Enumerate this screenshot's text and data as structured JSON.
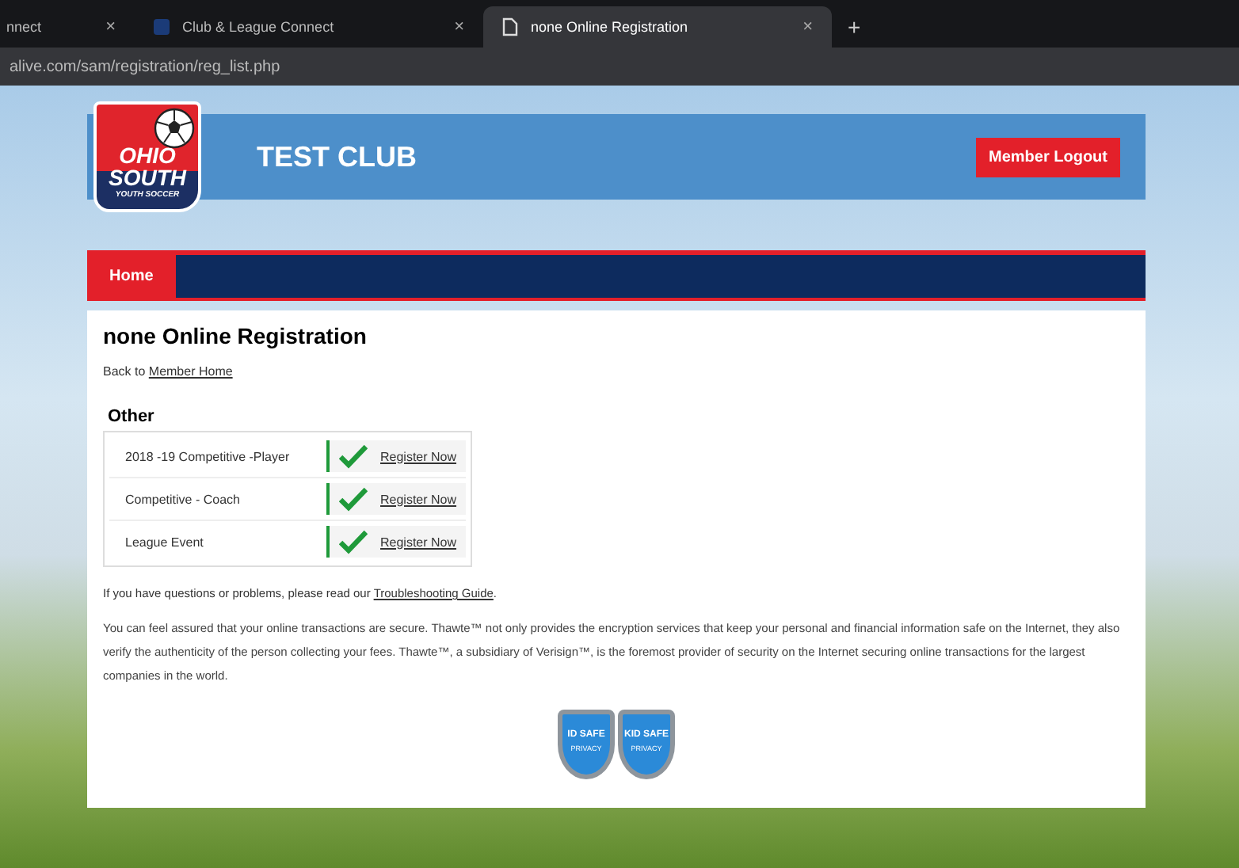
{
  "browser": {
    "tabs": [
      {
        "title": "nnect",
        "selected": false,
        "close": "×",
        "kind": "plain"
      },
      {
        "title": "Club & League Connect",
        "selected": false,
        "close": "×",
        "kind": "site"
      },
      {
        "title": "none Online Registration",
        "selected": true,
        "close": "×",
        "kind": "page"
      }
    ],
    "new_tab": "+",
    "address": "alive.com/sam/registration/reg_list.php"
  },
  "header": {
    "logo": {
      "lines": [
        "OHIO",
        "SOUTH",
        "YOUTH SOCCER"
      ]
    },
    "club_name": "TEST CLUB",
    "logout_button": "Member Logout"
  },
  "nav": [
    {
      "label": "Home",
      "selected": true
    }
  ],
  "content": {
    "title": "none Online Registration",
    "back_text": "Back to ",
    "back_link": "Member Home",
    "section": "Other",
    "registrations": [
      {
        "name": "2018 -19 Competitive -Player",
        "action": "Register Now"
      },
      {
        "name": "Competitive - Coach",
        "action": "Register Now"
      },
      {
        "name": "League Event",
        "action": "Register Now"
      }
    ],
    "help_text": "If you have questions or problems, please read our ",
    "help_link": "Troubleshooting Guide",
    "help_end": ".",
    "security_text": "You can feel assured that your online transactions are secure. Thawte™ not only provides the encryption services that keep your personal and financial information safe on the Internet, they also verify the authenticity of the person collecting your fees. Thawte™, a subsidiary of Verisign™, is the foremost provider of security on the Internet securing online transactions for the largest companies in the world.",
    "badges": [
      {
        "top": "ID SAFE",
        "bottom": "PRIVACY"
      },
      {
        "top": "KID SAFE",
        "bottom": "PRIVACY"
      }
    ]
  }
}
